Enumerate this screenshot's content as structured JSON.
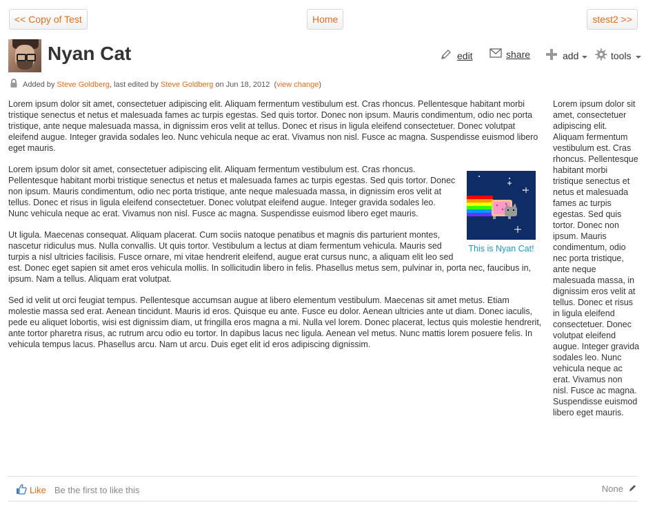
{
  "nav": {
    "prev_label": "<< Copy of Test",
    "home_label": "Home",
    "next_label": "stest2 >>"
  },
  "page": {
    "title": "Nyan Cat"
  },
  "actions": {
    "edit": "edit",
    "share": "share",
    "add": "add",
    "tools": "tools"
  },
  "meta": {
    "added_by_prefix": "Added by",
    "author": "Steve Goldberg",
    "edited_by_text": ", last edited by",
    "editor": "Steve Goldberg",
    "date_text": "on Jun 18, 2012",
    "view_change": "view change"
  },
  "content": {
    "paragraphs": [
      "Lorem ipsum dolor sit amet, consectetuer adipiscing elit. Aliquam fermentum vestibulum est. Cras rhoncus. Pellentesque habitant morbi tristique senectus et netus et malesuada fames ac turpis egestas. Sed quis tortor. Donec non ipsum. Mauris condimentum, odio nec porta tristique, ante neque malesuada massa, in dignissim eros velit at tellus. Donec et risus in ligula eleifend consectetuer. Donec volutpat eleifend augue. Integer gravida sodales leo. Nunc vehicula neque ac erat. Vivamus non nisl. Fusce ac magna. Suspendisse euismod libero eget mauris.",
      "Lorem ipsum dolor sit amet, consectetuer adipiscing elit. Aliquam fermentum vestibulum est. Cras rhoncus. Pellentesque habitant morbi tristique senectus et netus et malesuada fames ac turpis egestas. Sed quis tortor. Donec non ipsum. Mauris condimentum, odio nec porta tristique, ante neque malesuada massa, in dignissim eros velit at tellus. Donec et risus in ligula eleifend consectetuer. Donec volutpat eleifend augue. Integer gravida sodales leo. Nunc vehicula neque ac erat. Vivamus non nisl. Fusce ac magna. Suspendisse euismod libero eget mauris.",
      "Ut ligula. Maecenas consequat. Aliquam placerat. Cum sociis natoque penatibus et magnis dis parturient montes, nascetur ridiculus mus. Nulla convallis. Ut quis tortor. Vestibulum a lectus at diam fermentum vehicula. Mauris sed turpis a nisl ultricies facilisis. Fusce ornare, mi vitae hendrerit eleifend, augue erat cursus nunc, a aliquam elit leo sed est. Donec eget sapien sit amet eros vehicula mollis. In sollicitudin libero in felis. Phasellus metus sem, pulvinar in, porta nec, faucibus in, ipsum. Nam a tellus. Aliquam erat volutpat.",
      "Sed id velit ut orci feugiat tempus. Pellentesque accumsan augue at libero elementum vestibulum. Maecenas sit amet metus. Etiam molestie massa sed erat. Aenean tincidunt. Mauris id eros. Quisque eu ante. Fusce eu dolor. Aenean ultricies ante ut diam. Donec iaculis, pede eu aliquet lobortis, wisi est dignissim diam, ut fringilla eros magna a mi. Nulla vel lorem. Donec placerat, lectus quis molestie hendrerit, ante tortor pharetra risus, ac rutrum arcu odio eu tortor. In dapibus lacus nec ligula. Aenean vel metus. Nunc mattis lorem posuere felis. In vehicula tempus lacus. Phasellus arcu. Nam ut arcu. Duis eget elit id eros adipiscing dignissim."
    ],
    "figure_caption": "This is Nyan Cat!"
  },
  "sidebar": {
    "text": "Lorem ipsum dolor sit amet, consectetuer adipiscing elit. Aliquam fermentum vestibulum est. Cras rhoncus. Pellentesque habitant morbi tristique senectus et netus et malesuada fames ac turpis egestas. Sed quis tortor. Donec non ipsum. Mauris condimentum, odio nec porta tristique, ante neque malesuada massa, in dignissim eros velit at tellus. Donec et risus in ligula eleifend consectetuer. Donec volutpat eleifend augue. Integer gravida sodales leo. Nunc vehicula neque ac erat. Vivamus non nisl. Fusce ac magna. Suspendisse euismod libero eget mauris."
  },
  "footer": {
    "like_label": "Like",
    "like_status": "Be the first to like this",
    "labels_value": "None"
  },
  "icons": {
    "edit": "pencil-icon",
    "share": "envelope-icon",
    "add": "plus-icon",
    "tools": "gear-icon",
    "lock": "lock-icon",
    "like": "thumbs-up-icon",
    "labels_edit": "pencil-icon"
  },
  "colors": {
    "link": "#e46c1b",
    "caption": "#1a9ac8",
    "text": "#333333"
  }
}
